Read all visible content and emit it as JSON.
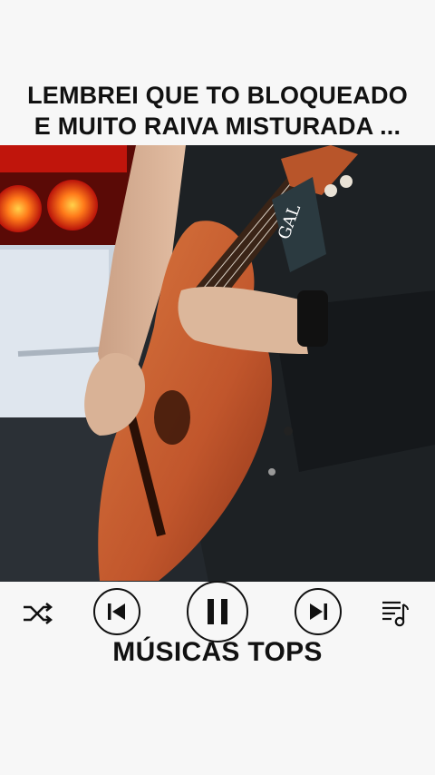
{
  "caption": {
    "line1": "LEMBREI QUE TO BLOQUEADO",
    "line2": "E MUITO RAIVA MISTURADA ..."
  },
  "video": {
    "strap_text": "GAL"
  },
  "player": {
    "controls": [
      {
        "id": "shuffle",
        "icon": "shuffle-icon"
      },
      {
        "id": "previous",
        "icon": "skip-previous-icon"
      },
      {
        "id": "pause",
        "icon": "pause-icon"
      },
      {
        "id": "next",
        "icon": "skip-next-icon"
      },
      {
        "id": "playlist",
        "icon": "playlist-icon"
      }
    ],
    "title": "MÚSICAS TOPS"
  },
  "colors": {
    "background": "#f7f7f7",
    "text": "#111111",
    "guitar": "#c8643a",
    "shirt": "#1d2124"
  }
}
